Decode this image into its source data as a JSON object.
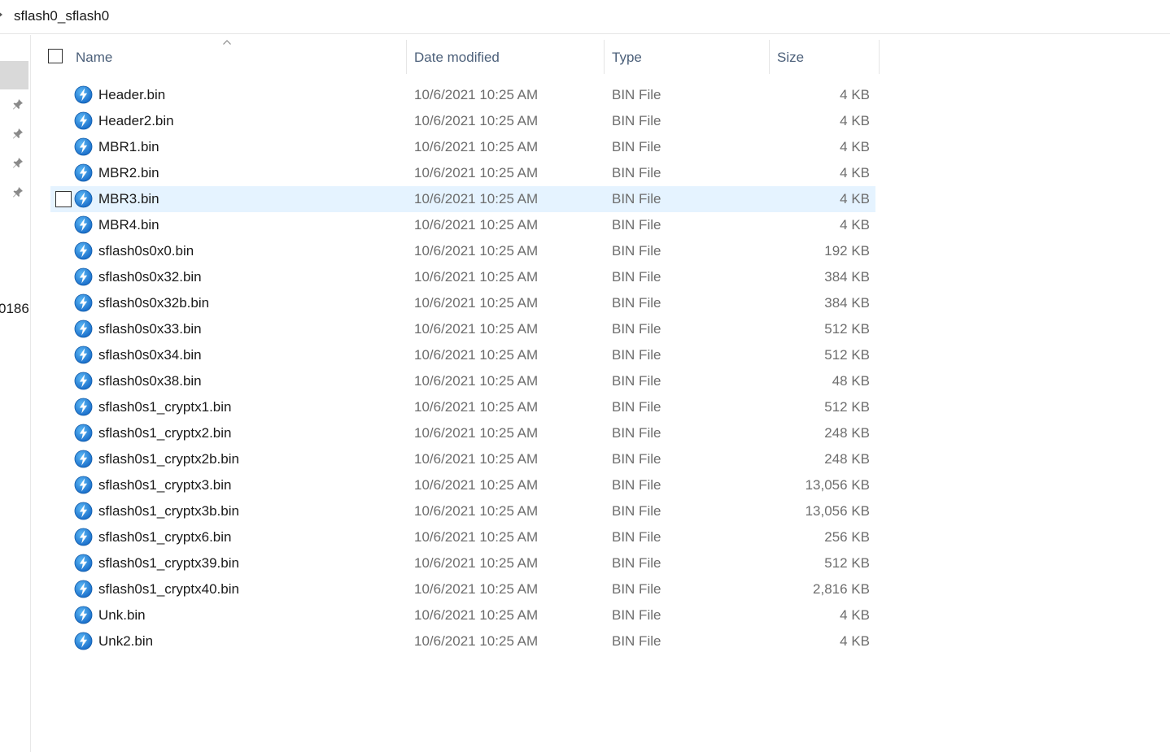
{
  "address": {
    "path": "sflash0_sflash0"
  },
  "nav": {
    "partial_label": "0186"
  },
  "columns": {
    "name": "Name",
    "date": "Date modified",
    "type": "Type",
    "size": "Size"
  },
  "files": [
    {
      "name": "Header.bin",
      "date": "10/6/2021 10:25 AM",
      "type": "BIN File",
      "size": "4 KB"
    },
    {
      "name": "Header2.bin",
      "date": "10/6/2021 10:25 AM",
      "type": "BIN File",
      "size": "4 KB"
    },
    {
      "name": "MBR1.bin",
      "date": "10/6/2021 10:25 AM",
      "type": "BIN File",
      "size": "4 KB"
    },
    {
      "name": "MBR2.bin",
      "date": "10/6/2021 10:25 AM",
      "type": "BIN File",
      "size": "4 KB"
    },
    {
      "name": "MBR3.bin",
      "date": "10/6/2021 10:25 AM",
      "type": "BIN File",
      "size": "4 KB",
      "hovered": true
    },
    {
      "name": "MBR4.bin",
      "date": "10/6/2021 10:25 AM",
      "type": "BIN File",
      "size": "4 KB"
    },
    {
      "name": "sflash0s0x0.bin",
      "date": "10/6/2021 10:25 AM",
      "type": "BIN File",
      "size": "192 KB"
    },
    {
      "name": "sflash0s0x32.bin",
      "date": "10/6/2021 10:25 AM",
      "type": "BIN File",
      "size": "384 KB"
    },
    {
      "name": "sflash0s0x32b.bin",
      "date": "10/6/2021 10:25 AM",
      "type": "BIN File",
      "size": "384 KB"
    },
    {
      "name": "sflash0s0x33.bin",
      "date": "10/6/2021 10:25 AM",
      "type": "BIN File",
      "size": "512 KB"
    },
    {
      "name": "sflash0s0x34.bin",
      "date": "10/6/2021 10:25 AM",
      "type": "BIN File",
      "size": "512 KB"
    },
    {
      "name": "sflash0s0x38.bin",
      "date": "10/6/2021 10:25 AM",
      "type": "BIN File",
      "size": "48 KB"
    },
    {
      "name": "sflash0s1_cryptx1.bin",
      "date": "10/6/2021 10:25 AM",
      "type": "BIN File",
      "size": "512 KB"
    },
    {
      "name": "sflash0s1_cryptx2.bin",
      "date": "10/6/2021 10:25 AM",
      "type": "BIN File",
      "size": "248 KB"
    },
    {
      "name": "sflash0s1_cryptx2b.bin",
      "date": "10/6/2021 10:25 AM",
      "type": "BIN File",
      "size": "248 KB"
    },
    {
      "name": "sflash0s1_cryptx3.bin",
      "date": "10/6/2021 10:25 AM",
      "type": "BIN File",
      "size": "13,056 KB"
    },
    {
      "name": "sflash0s1_cryptx3b.bin",
      "date": "10/6/2021 10:25 AM",
      "type": "BIN File",
      "size": "13,056 KB"
    },
    {
      "name": "sflash0s1_cryptx6.bin",
      "date": "10/6/2021 10:25 AM",
      "type": "BIN File",
      "size": "256 KB"
    },
    {
      "name": "sflash0s1_cryptx39.bin",
      "date": "10/6/2021 10:25 AM",
      "type": "BIN File",
      "size": "512 KB"
    },
    {
      "name": "sflash0s1_cryptx40.bin",
      "date": "10/6/2021 10:25 AM",
      "type": "BIN File",
      "size": "2,816 KB"
    },
    {
      "name": "Unk.bin",
      "date": "10/6/2021 10:25 AM",
      "type": "BIN File",
      "size": "4 KB"
    },
    {
      "name": "Unk2.bin",
      "date": "10/6/2021 10:25 AM",
      "type": "BIN File",
      "size": "4 KB"
    }
  ],
  "icons": {
    "file": "flash-file-icon",
    "pin": "pin-icon",
    "sort": "sort-ascending-icon"
  },
  "colors": {
    "hover_row": "#e5f3ff",
    "header_text": "#4c607a",
    "icon_blue": "#1a7fd4"
  }
}
